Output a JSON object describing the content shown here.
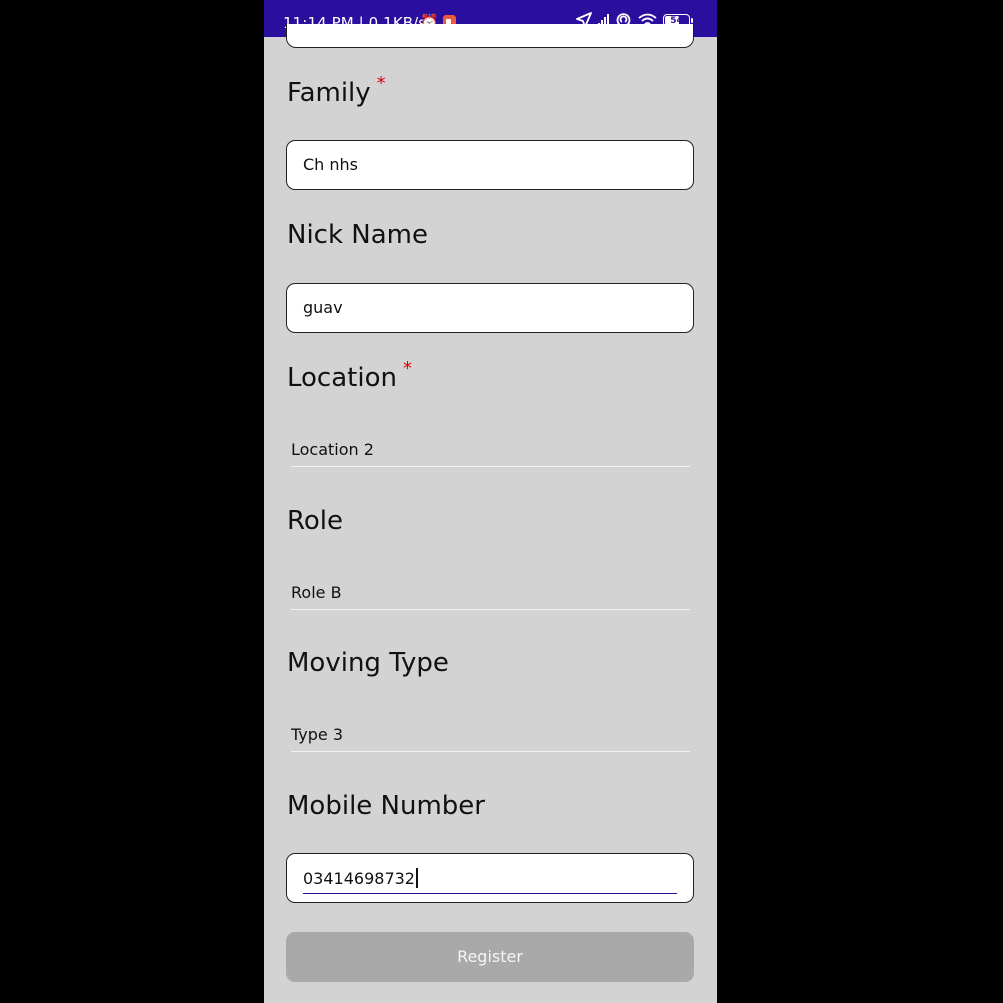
{
  "status_bar": {
    "time_speed": "11:14 PM | 0.1KB/s",
    "battery": "54"
  },
  "form": {
    "family": {
      "label": "Family",
      "required_mark": "*",
      "value": "Ch nhs"
    },
    "nick_name": {
      "label": "Nick Name",
      "value": "guav"
    },
    "location": {
      "label": "Location",
      "required_mark": "*",
      "value": "Location 2"
    },
    "role": {
      "label": "Role",
      "value": "Role B"
    },
    "moving_type": {
      "label": "Moving Type",
      "value": "Type 3"
    },
    "mobile_number": {
      "label": "Mobile Number",
      "value": "03414698732"
    },
    "register_label": "Register"
  },
  "colors": {
    "status_bar": "#2a0f9e",
    "background": "#d3d3d3",
    "required": "#e00000",
    "button_disabled": "#a9a9a9"
  }
}
